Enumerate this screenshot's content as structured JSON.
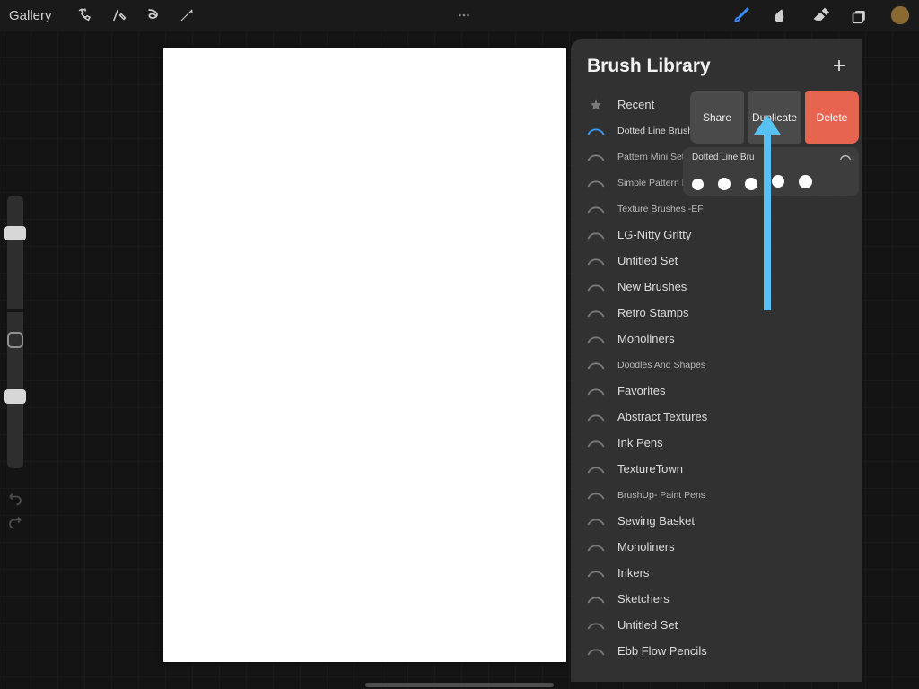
{
  "toolbar": {
    "gallery_label": "Gallery"
  },
  "panel": {
    "title": "Brush Library"
  },
  "categories": [
    {
      "label": "Recent",
      "icon": "star",
      "small": false,
      "selected": false
    },
    {
      "label": "Dotted Line Brushes",
      "icon": "swoosh",
      "small": true,
      "selected": true
    },
    {
      "label": "Pattern Mini Set - EF",
      "icon": "swoosh",
      "small": true,
      "selected": false
    },
    {
      "label": "Simple Pattern Brush…",
      "icon": "swoosh",
      "small": true,
      "selected": false
    },
    {
      "label": "Texture Brushes -EF",
      "icon": "swoosh",
      "small": true,
      "selected": false
    },
    {
      "label": "LG-Nitty Gritty",
      "icon": "swoosh",
      "small": false,
      "selected": false
    },
    {
      "label": "Untitled Set",
      "icon": "swoosh",
      "small": false,
      "selected": false
    },
    {
      "label": "New Brushes",
      "icon": "swoosh",
      "small": false,
      "selected": false
    },
    {
      "label": "Retro Stamps",
      "icon": "swoosh",
      "small": false,
      "selected": false
    },
    {
      "label": "Monoliners",
      "icon": "swoosh",
      "small": false,
      "selected": false
    },
    {
      "label": "Doodles And Shapes",
      "icon": "swoosh",
      "small": true,
      "selected": false
    },
    {
      "label": "Favorites",
      "icon": "swoosh",
      "small": false,
      "selected": false
    },
    {
      "label": "Abstract Textures",
      "icon": "swoosh",
      "small": false,
      "selected": false
    },
    {
      "label": "Ink Pens",
      "icon": "swoosh",
      "small": false,
      "selected": false
    },
    {
      "label": "TextureTown",
      "icon": "swoosh",
      "small": false,
      "selected": false
    },
    {
      "label": "BrushUp- Paint Pens",
      "icon": "swoosh",
      "small": true,
      "selected": false
    },
    {
      "label": "Sewing Basket",
      "icon": "swoosh",
      "small": false,
      "selected": false
    },
    {
      "label": "Monoliners",
      "icon": "swoosh",
      "small": false,
      "selected": false
    },
    {
      "label": "Inkers",
      "icon": "swoosh",
      "small": false,
      "selected": false
    },
    {
      "label": "Sketchers",
      "icon": "swoosh",
      "small": false,
      "selected": false
    },
    {
      "label": "Untitled Set",
      "icon": "swoosh",
      "small": false,
      "selected": false
    },
    {
      "label": "Ebb Flow Pencils",
      "icon": "swoosh",
      "small": false,
      "selected": false
    }
  ],
  "swipe": {
    "share": "Share",
    "duplicate": "Duplicate",
    "delete": "Delete"
  },
  "brush_card": {
    "name": "Dotted Line Bru"
  }
}
